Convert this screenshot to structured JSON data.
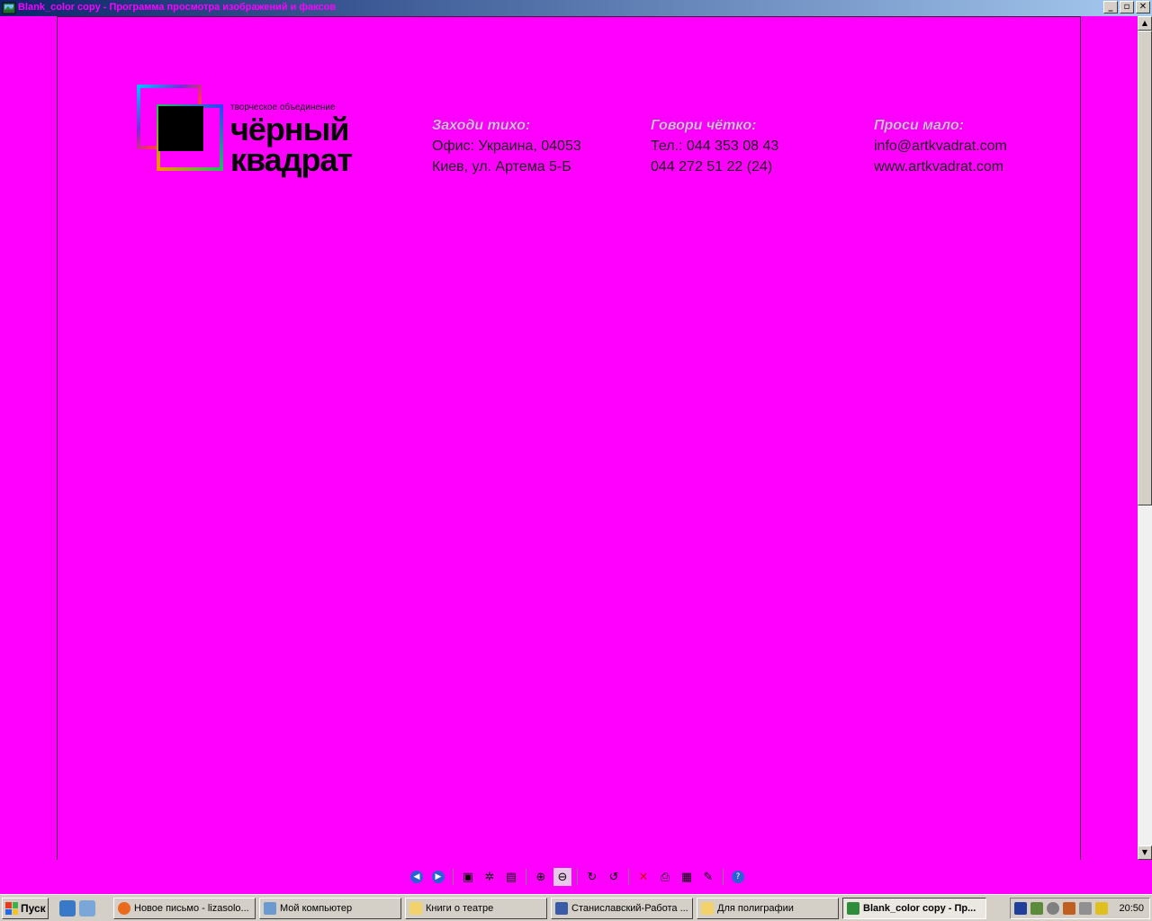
{
  "window": {
    "title": "Blank_color copy - Программа просмотра изображений и факсов",
    "minimize": "_",
    "maximize": "▫",
    "close": "✕"
  },
  "document": {
    "logo": {
      "tagline": "творческое объединение",
      "line1": "чёрный",
      "line2": "квадрат"
    },
    "columns": [
      {
        "head": "Заходи тихо:",
        "lines": [
          "Офис: Украина, 04053",
          "Киев, ул. Артема 5-Б"
        ]
      },
      {
        "head": "Говори чётко:",
        "lines": [
          "Тел.: 044 353 08 43",
          "044 272 51 22 (24)"
        ]
      },
      {
        "head": "Проси мало:",
        "lines": [
          "info@artkvadrat.com",
          "www.artkvadrat.com"
        ]
      }
    ]
  },
  "toolbar": {
    "icons": [
      "previous-image-icon",
      "next-image-icon",
      "best-fit-icon",
      "actual-size-icon",
      "slideshow-icon",
      "zoom-in-icon",
      "zoom-out-icon",
      "rotate-clockwise-icon",
      "rotate-counterclockwise-icon",
      "delete-icon",
      "print-icon",
      "copy-to-icon",
      "edit-icon",
      "help-icon"
    ]
  },
  "taskbar": {
    "start_label": "Пуск",
    "tasks": [
      {
        "label": "Новое письмо - lizasolo...",
        "icon": "firefox-icon"
      },
      {
        "label": "Мой компьютер",
        "icon": "computer-icon"
      },
      {
        "label": "Книги о театре",
        "icon": "folder-icon"
      },
      {
        "label": "Станиславский-Работа ...",
        "icon": "document-icon"
      },
      {
        "label": "Для полиграфии",
        "icon": "folder-icon"
      },
      {
        "label": "Blank_color copy - Пр...",
        "icon": "image-viewer-icon",
        "active": true
      }
    ],
    "clock": "20:50"
  },
  "colors": {
    "canvas": "#ff00ff",
    "titlebar_start": "#0a246a",
    "titlebar_end": "#a6caf0",
    "chrome": "#d4d0c8"
  }
}
